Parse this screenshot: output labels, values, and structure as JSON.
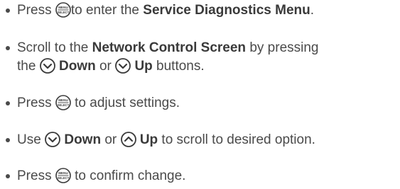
{
  "instructions": [
    {
      "parts": [
        "Press ",
        "to enter the ",
        "Service Diagnostics Menu",
        "."
      ],
      "icon": "menu-select-button"
    },
    {
      "parts": [
        "Scroll to the ",
        "Network Control Screen",
        " by pressing",
        "the ",
        "Down",
        " or ",
        "Up",
        " buttons."
      ],
      "icons": [
        "chevron-down-button",
        "chevron-down-button"
      ]
    },
    {
      "parts": [
        "Press ",
        " to adjust settings."
      ],
      "icon": "menu-select-button"
    },
    {
      "parts": [
        "Use ",
        "Down",
        " or ",
        "Up",
        " to scroll to desired option."
      ],
      "icons": [
        "chevron-down-button",
        "chevron-up-button"
      ]
    },
    {
      "parts": [
        "Press ",
        " to confirm change."
      ],
      "icon": "menu-select-button"
    }
  ],
  "icon_text": {
    "menu_top": "MENU",
    "menu_bottom": "SELECT"
  }
}
